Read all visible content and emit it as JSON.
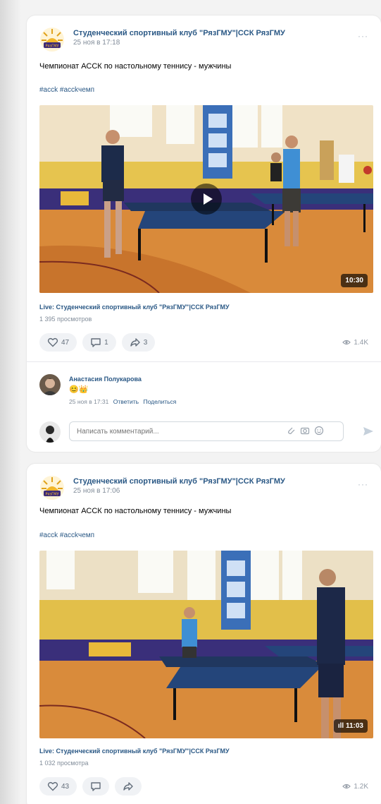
{
  "posts": [
    {
      "author": "Студенческий спортивный клуб \"РязГМУ\"|ССК РязГМУ",
      "date": "25 ноя в 17:18",
      "text": "Чемпионат АССК по настольному теннису - мужчины",
      "hashtags": "#ассk #ассkчемп",
      "video_duration": "10:30",
      "live_title": "Live: Студенческий спортивный клуб \"РязГМУ\"|ССК РязГМУ",
      "views_text": "1 395 просмотров",
      "likes": "47",
      "comments": "1",
      "shares": "3",
      "view_count": "1.4K"
    },
    {
      "author": "Студенческий спортивный клуб \"РязГМУ\"|ССК РязГМУ",
      "date": "25 ноя в 17:06",
      "text": "Чемпионат АССК по настольному теннису - мужчины",
      "hashtags": "#ассk #ассkчемп",
      "video_duration": "11:03",
      "live_title": "Live: Студенческий спортивный клуб \"РязГМУ\"|ССК РязГМУ",
      "views_text": "1 032 просмотра",
      "likes": "43",
      "comments": "",
      "shares": "",
      "view_count": "1.2K"
    }
  ],
  "comment": {
    "author": "Анастасия Полукарова",
    "emoji": "😊👑",
    "date": "25 ноя в 17:31",
    "reply": "Ответить",
    "share": "Поделиться"
  },
  "compose": {
    "placeholder": "Написать комментарий..."
  },
  "more_label": "···",
  "colors": {
    "link": "#2a5885",
    "muted": "#818c99",
    "action_bg": "#f0f2f5"
  }
}
